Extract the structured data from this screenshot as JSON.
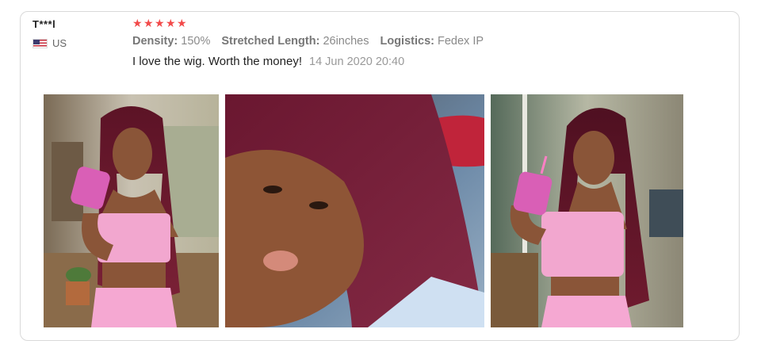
{
  "review": {
    "username": "T***l",
    "country": "US",
    "rating": 5,
    "attributes": [
      {
        "label": "Density:",
        "value": "150%"
      },
      {
        "label": "Stretched Length:",
        "value": "26inches"
      },
      {
        "label": "Logistics:",
        "value": "Fedex IP"
      }
    ],
    "comment": "I love the wig. Worth the money!",
    "date": "14 Jun 2020 20:40",
    "photos": [
      {
        "subject": "woman-burgundy-wig-drinking-pink-cup"
      },
      {
        "subject": "woman-burgundy-wig-closeup-selfie"
      },
      {
        "subject": "woman-burgundy-wig-holding-pink-cup"
      }
    ]
  },
  "colors": {
    "star": "#f24a4a",
    "hair": "#6e1a2e",
    "top": "#f2a7cf",
    "skin": "#8a5538",
    "border": "#d9d9d9"
  }
}
